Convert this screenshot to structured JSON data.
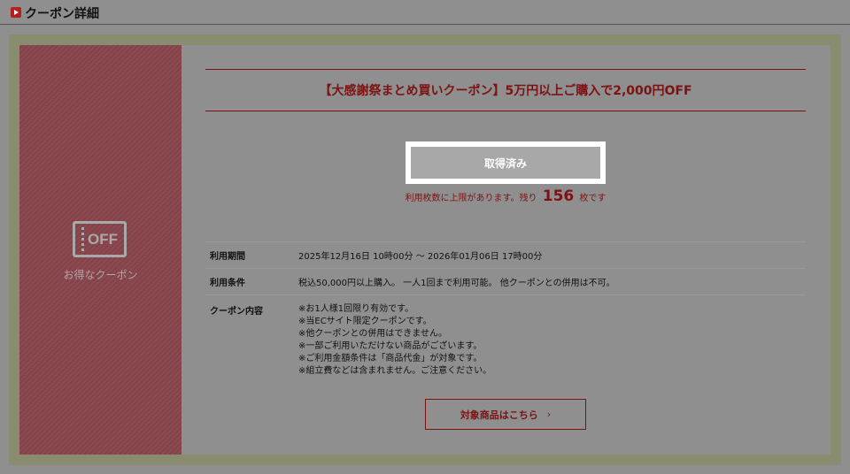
{
  "header": {
    "title": "クーポン詳細",
    "icon": "play-icon"
  },
  "coupon_badge": {
    "icon_text": "OFF",
    "caption": "お得なクーポン"
  },
  "coupon": {
    "title": "【大感謝祭まとめ買いクーポン】5万円以上ご購入で2,000円OFF",
    "acquired_label": "取得済み",
    "remaining_prefix": "利用枚数に上限があります。残り",
    "remaining_count": "156",
    "remaining_suffix": "枚です"
  },
  "details": {
    "period_label": "利用期間",
    "period_value": "2025年12月16日 10時00分 ～ 2026年01月06日 17時00分",
    "conditions_label": "利用条件",
    "conditions_value": "税込50,000円以上購入。 一人1回まで利用可能。 他クーポンとの併用は不可。",
    "content_label": "クーポン内容",
    "content_lines": [
      "※お1人様1回限り有効です。",
      "※当ECサイト限定クーポンです。",
      "※他クーポンとの併用はできません。",
      "※一部ご利用いただけない商品がございます。",
      "※ご利用金額条件は「商品代金」が対象です。",
      "※組立費などは含まれません。ご注意ください。"
    ]
  },
  "target_button": {
    "label": "対象商品はこちら",
    "icon": "chevron-right-icon"
  },
  "colors": {
    "accent": "#7d1212",
    "overlay": "#8f8f8f"
  }
}
